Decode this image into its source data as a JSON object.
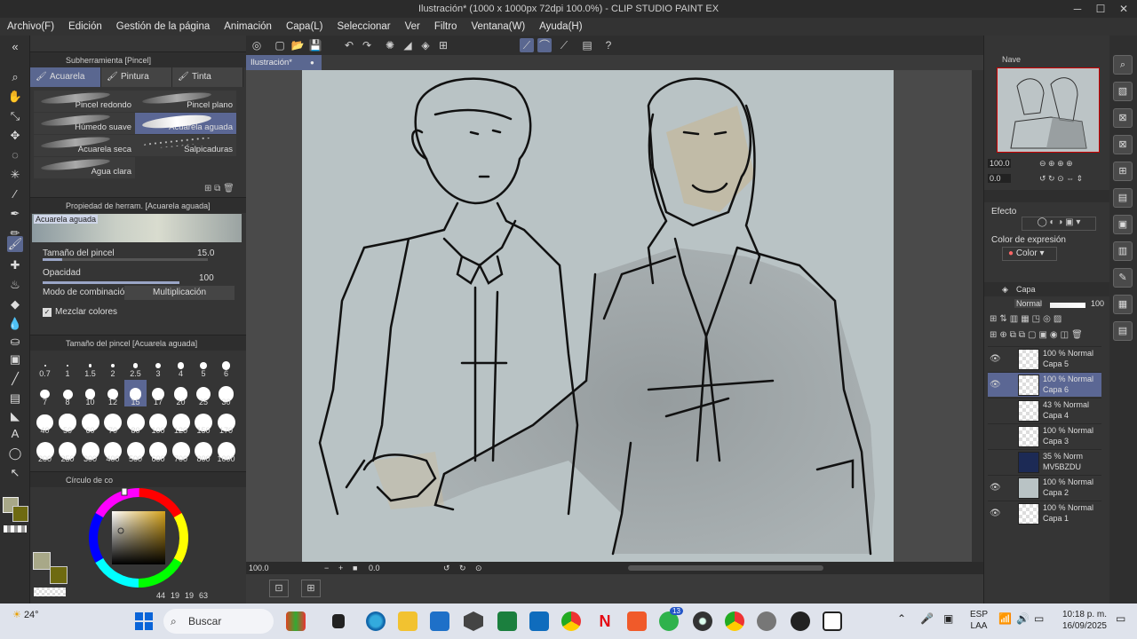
{
  "window": {
    "title": "Ilustración* (1000 x 1000px 72dpi 100.0%) - CLIP STUDIO PAINT EX"
  },
  "menu": [
    "Archivo(F)",
    "Edición",
    "Gestión de la página",
    "Animación",
    "Capa(L)",
    "Seleccionar",
    "Ver",
    "Filtro",
    "Ventana(W)",
    "Ayuda(H)"
  ],
  "subtool": {
    "header": "Subherramienta [Pincel]",
    "tabs": [
      "Acuarela",
      "Pintura espes",
      "Tinta"
    ],
    "brushes": [
      "Pincel redondo",
      "Pincel plano",
      "Húmedo suave",
      "Acuarela aguada",
      "Acuarela seca",
      "Salpicaduras",
      "Agua clara"
    ]
  },
  "toolprop": {
    "header": "Propiedad de herram. [Acuarela aguada]",
    "preset_name": "Acuarela aguada",
    "size_label": "Tamaño del pincel",
    "size_value": "15.0",
    "opacity_label": "Opacidad",
    "opacity_value": "100",
    "blend_label": "Modo de combinación",
    "blend_value": "Multiplicación",
    "mix_label": "Mezclar colores"
  },
  "brushsize": {
    "header": "Tamaño del pincel [Acuarela aguada]",
    "sizes": [
      "0.7",
      "1",
      "1.5",
      "2",
      "2.5",
      "3",
      "4",
      "5",
      "6",
      "7",
      "8",
      "10",
      "12",
      "15",
      "17",
      "20",
      "25",
      "30",
      "40",
      "50",
      "60",
      "70",
      "80",
      "100",
      "120",
      "150",
      "170",
      "200",
      "250",
      "300",
      "400",
      "500",
      "600",
      "700",
      "800",
      "1000"
    ],
    "selected": "15"
  },
  "colorwheel": {
    "header": "Círculo de co",
    "readout": [
      "44",
      "19",
      "19",
      "63"
    ]
  },
  "document": {
    "tab": "Ilustración*",
    "zoom": "100.0",
    "rotation": "0.0"
  },
  "navigator": {
    "header": "Nave",
    "zoom": "100.0",
    "angle": "0.0"
  },
  "effect": {
    "label": "Efecto",
    "expression_label": "Color de expresión",
    "expression_value": "Color"
  },
  "layers": {
    "header": "Capa",
    "blend": "Normal",
    "opacity": "100",
    "items": [
      {
        "opacity": "100 % Normal",
        "name": "Capa 5",
        "visible": true
      },
      {
        "opacity": "100 % Normal",
        "name": "Capa 6",
        "visible": true,
        "selected": true
      },
      {
        "opacity": "43 % Normal",
        "name": "Capa 4",
        "visible": false
      },
      {
        "opacity": "100 % Normal",
        "name": "Capa 3",
        "visible": false
      },
      {
        "opacity": "35 % Norm",
        "name": "MV5BZDU",
        "visible": false
      },
      {
        "opacity": "100 % Normal",
        "name": "Capa 2",
        "visible": true
      },
      {
        "opacity": "100 % Normal",
        "name": "Capa 1",
        "visible": true
      }
    ]
  },
  "taskbar": {
    "weather": "24°",
    "search": "Buscar",
    "lang": "ESP",
    "lang2": "LAA",
    "time": "10:18 p. m.",
    "date": "16/09/2025",
    "badge": "13"
  },
  "colors": {
    "accent": "#5a6790",
    "panel": "#353535",
    "canvas": "#b9c3c5"
  }
}
